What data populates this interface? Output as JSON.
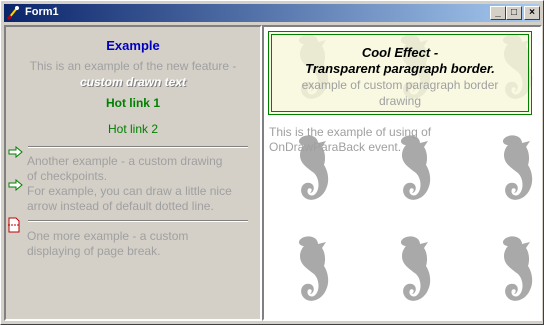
{
  "window": {
    "title": "Form1",
    "buttons": {
      "minimize": "_",
      "maximize": "□",
      "close": "×"
    }
  },
  "left": {
    "heading": "Example",
    "intro_line1": "This is an example of the new feature -",
    "intro_line2": "custom drawn text",
    "hotlink1": "Hot link 1",
    "hotlink2": "Hot link 2",
    "checkpoints_text": [
      "Another example - a custom drawing",
      "of checkpoints.",
      "For example, you can draw a little nice",
      "arrow instead of default dotted line."
    ],
    "pagebreak_text": [
      "One more example - a custom",
      "displaying of page break."
    ]
  },
  "right": {
    "box_title1": "Cool Effect -",
    "box_title2": "Transparent paragraph border.",
    "box_sub1": "example of custom paragraph border",
    "box_sub2": "drawing",
    "bg_text1": "This is the example of using of",
    "bg_text2": "OnDrawParaBack event."
  },
  "colors": {
    "heading": "#0000c0",
    "hotlink": "#008000",
    "dim_text": "#a0a0a0",
    "box_bg": "#f8f8dc",
    "box_border": "#008000",
    "titlebar": "#0a246a"
  }
}
